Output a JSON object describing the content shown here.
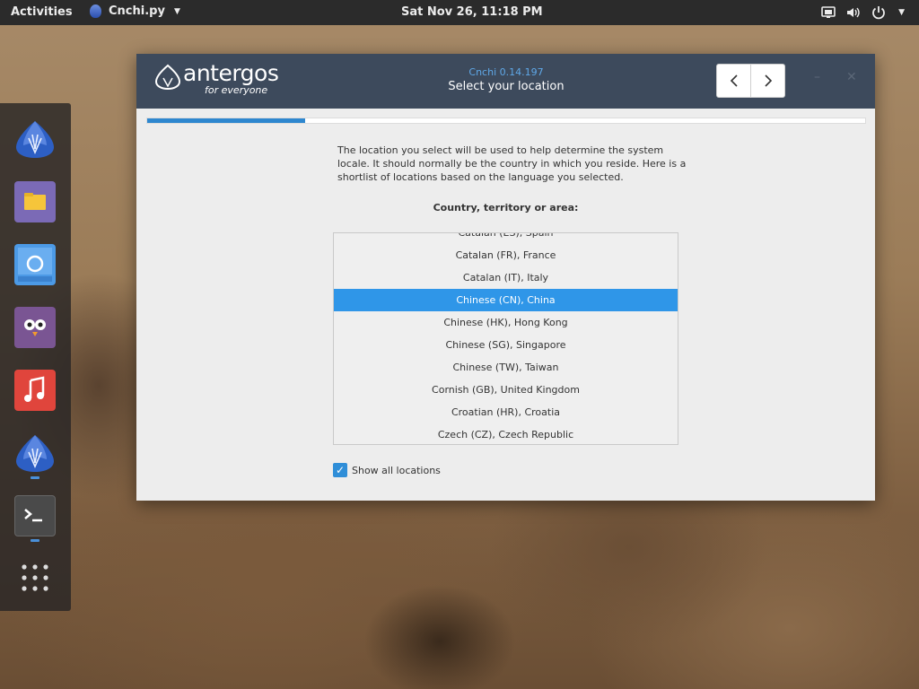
{
  "topbar": {
    "activities": "Activities",
    "app_name": "Cnchi.py",
    "clock": "Sat Nov 26, 11:18 PM"
  },
  "dock": {
    "items": [
      {
        "name": "antergos-installer"
      },
      {
        "name": "files"
      },
      {
        "name": "chromium"
      },
      {
        "name": "pidgin"
      },
      {
        "name": "music"
      },
      {
        "name": "cnchi-running"
      },
      {
        "name": "terminal"
      },
      {
        "name": "show-applications"
      }
    ]
  },
  "installer": {
    "brand": "antergos",
    "tagline": "for everyone",
    "version": "Cnchi  0.14.197",
    "step_title": "Select your location",
    "progress_percent": 22,
    "description": "The location you select will be used to help determine the system locale. It should normally be the country in which you reside. Here is a shortlist of locations based on the language you selected.",
    "list_heading": "Country, territory or area:",
    "locations": [
      "Catalan (ES), Spain",
      "Catalan (FR), France",
      "Catalan (IT), Italy",
      "Chinese (CN), China",
      "Chinese (HK), Hong Kong",
      "Chinese (SG), Singapore",
      "Chinese (TW), Taiwan",
      "Cornish (GB), United Kingdom",
      "Croatian (HR), Croatia",
      "Czech (CZ), Czech Republic"
    ],
    "selected_location": "Chinese (CN), China",
    "show_all_label": "Show all locations",
    "show_all_checked": true
  },
  "colors": {
    "accent": "#2f96e8",
    "header_bg": "#3d4a5c",
    "topbar_bg": "#2b2b2b"
  }
}
